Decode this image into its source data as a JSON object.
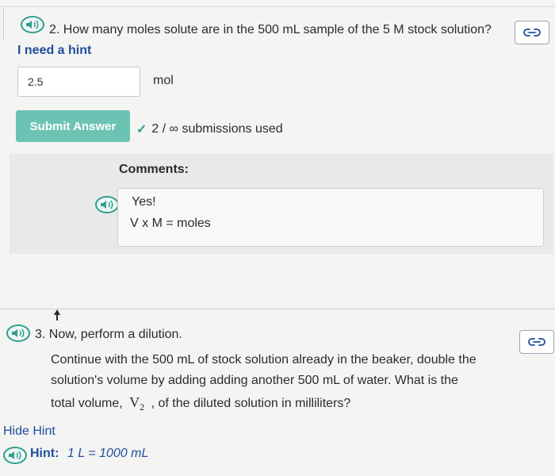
{
  "question2": {
    "number_text": "2. How many moles solute are in the 500 mL sample of the 5 M stock solution?",
    "hint_label": "I need a hint",
    "answer_value": "2.5",
    "unit": "mol",
    "submit_label": "Submit Answer",
    "submissions_text": "2 / ∞ submissions used",
    "comments_label": "Comments:",
    "comment_lines": [
      "Yes!",
      "V x M = moles"
    ]
  },
  "question3": {
    "line1": "3. Now, perform a dilution.",
    "line2": "Continue with the 500 mL of stock solution already in the beaker, double the",
    "line3": "solution's volume by adding adding another 500 mL of water. What is the",
    "line4_prefix": "total volume,",
    "line4_var": "V",
    "line4_sub": "2",
    "line4_suffix": ", of the diluted solution in milliliters?",
    "hide_hint_label": "Hide Hint",
    "hint_prefix": "Hint:",
    "hint_expression": "1 L = 1000 mL"
  },
  "colors": {
    "accent": "#2f9e8f",
    "submit_bg": "#6cc3b4",
    "link": "#1f4e9c"
  },
  "icons": [
    "speaker-icon",
    "link-icon",
    "checkmark-icon",
    "cursor-icon"
  ]
}
